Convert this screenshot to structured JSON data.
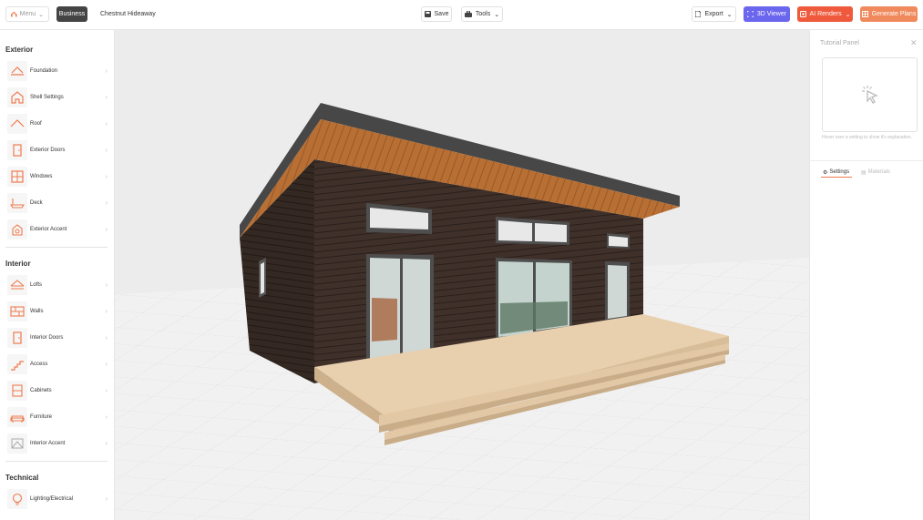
{
  "topbar": {
    "menu_label": "Menu",
    "business_label": "Business",
    "project_name": "Chestnut Hideaway",
    "save_label": "Save",
    "tools_label": "Tools",
    "export_label": "Export",
    "viewer_label": "3D Viewer",
    "renders_label": "AI Renders",
    "plans_label": "Generate Plans"
  },
  "sidebar": {
    "exterior_title": "Exterior",
    "interior_title": "Interior",
    "technical_title": "Technical",
    "exterior_items": [
      {
        "label": "Foundation",
        "icon": "foundation-icon"
      },
      {
        "label": "Shell Settings",
        "icon": "house-shell-icon"
      },
      {
        "label": "Roof",
        "icon": "roof-icon"
      },
      {
        "label": "Exterior Doors",
        "icon": "door-icon"
      },
      {
        "label": "Windows",
        "icon": "window-icon"
      },
      {
        "label": "Deck",
        "icon": "deck-icon"
      },
      {
        "label": "Exterior Accent",
        "icon": "accent-icon"
      }
    ],
    "interior_items": [
      {
        "label": "Lofts",
        "icon": "loft-icon"
      },
      {
        "label": "Walls",
        "icon": "wall-icon"
      },
      {
        "label": "Interior Doors",
        "icon": "door-icon"
      },
      {
        "label": "Access",
        "icon": "stairs-icon"
      },
      {
        "label": "Cabinets",
        "icon": "cabinet-icon"
      },
      {
        "label": "Furniture",
        "icon": "sofa-icon"
      },
      {
        "label": "Interior Accent",
        "icon": "accent-icon"
      }
    ],
    "technical_items": [
      {
        "label": "Lighting/Electrical",
        "icon": "bulb-icon"
      }
    ]
  },
  "right_panel": {
    "title": "Tutorial Panel",
    "hint": "Hover over a setting to show it's explanation.",
    "tabs": [
      {
        "label": "Settings",
        "active": true
      },
      {
        "label": "Materials",
        "active": false
      }
    ]
  },
  "colors": {
    "accent": "#ef7a4e",
    "viewer": "#6b66ee",
    "renders": "#ef5a3c",
    "plans": "#f08a5d"
  }
}
